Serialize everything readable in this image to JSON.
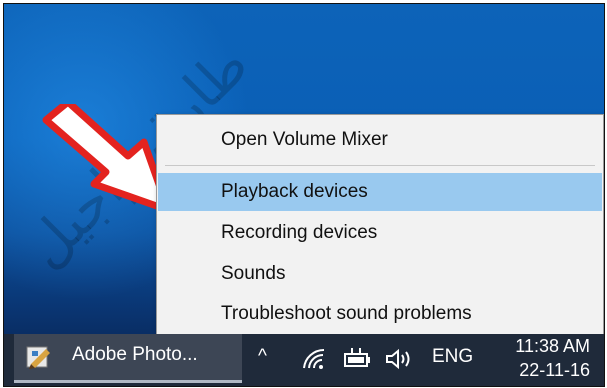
{
  "context_menu": {
    "items": [
      {
        "label": "Open Volume Mixer"
      },
      {
        "label": "Playback devices"
      },
      {
        "label": "Recording devices"
      },
      {
        "label": "Sounds"
      },
      {
        "label": "Troubleshoot sound problems"
      }
    ]
  },
  "watermark": {
    "text": "طارق راجيل"
  },
  "taskbar": {
    "app_label": "Adobe Photo...",
    "tray": {
      "chevron": "^",
      "language": "ENG"
    },
    "clock": {
      "time": "11:38 AM",
      "date": "22-11-16"
    }
  },
  "icons": [
    "photoshop-app-icon",
    "chevron-up-icon",
    "wifi-icon",
    "battery-icon",
    "speaker-icon"
  ],
  "colors": {
    "selected_item": "#99c9ef",
    "desktop_blue": "#0a5fb6",
    "taskbar": "#1f2a3a",
    "arrow_red": "#e3231f"
  }
}
